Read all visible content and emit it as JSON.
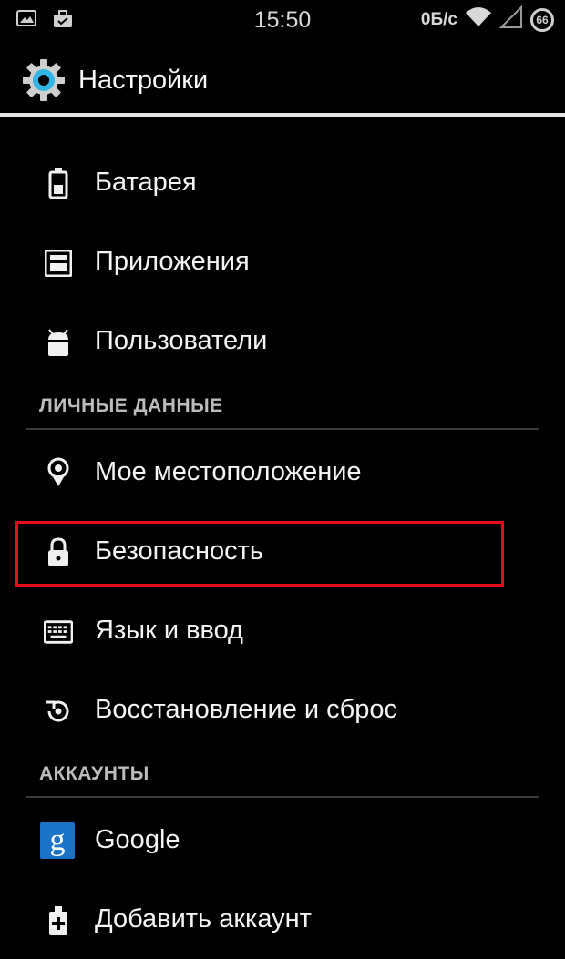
{
  "status_bar": {
    "time": "15:50",
    "net_speed": "0Б/с",
    "battery_level": "66",
    "icons": [
      "picture-notification-icon",
      "briefcase-notification-icon",
      "wifi-icon",
      "cell-signal-icon",
      "battery-circle-icon"
    ]
  },
  "action_bar": {
    "title": "Настройки",
    "icon": "settings-gear-icon"
  },
  "colors": {
    "background": "#000000",
    "text": "#f5f5f5",
    "section_header": "#bcbcbc",
    "highlight": "#e3101c",
    "google_blue": "#1a73c8",
    "gear_blue": "#33b5e5"
  },
  "groups": [
    {
      "items": [
        {
          "label": "Батарея",
          "icon": "battery-icon"
        },
        {
          "label": "Приложения",
          "icon": "apps-icon"
        },
        {
          "label": "Пользователи",
          "icon": "users-icon"
        }
      ]
    },
    {
      "header": "ЛИЧНЫЕ ДАННЫЕ",
      "items": [
        {
          "label": "Мое местоположение",
          "icon": "location-icon"
        },
        {
          "label": "Безопасность",
          "icon": "lock-icon",
          "highlighted": true
        },
        {
          "label": "Язык и ввод",
          "icon": "keyboard-icon"
        },
        {
          "label": "Восстановление и сброс",
          "icon": "backup-reset-icon"
        }
      ]
    },
    {
      "header": "АККАУНТЫ",
      "items": [
        {
          "label": "Google",
          "icon": "google-icon",
          "icon_glyph": "g"
        },
        {
          "label": "Добавить аккаунт",
          "icon": "add-account-icon"
        }
      ]
    }
  ]
}
